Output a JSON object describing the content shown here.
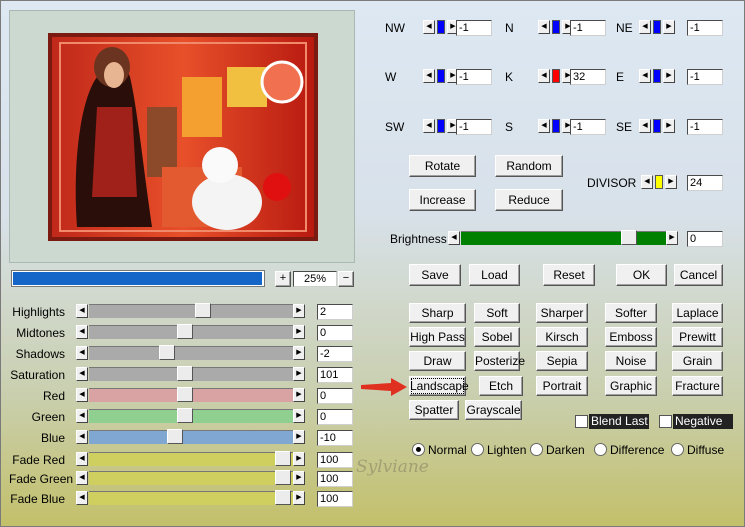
{
  "colors": {
    "thumb_blue": "#0000ff",
    "thumb_red": "#ff0000",
    "thumb_yellow": "#ffff00",
    "progress": "#1565c8",
    "brightness": "#008000",
    "arrow": "#e03020"
  },
  "compass": {
    "nw": {
      "label": "NW",
      "value": "-1"
    },
    "n": {
      "label": "N",
      "value": "-1"
    },
    "ne": {
      "label": "NE",
      "value": "-1"
    },
    "w": {
      "label": "W",
      "value": "-1"
    },
    "k": {
      "label": "K",
      "value": "32"
    },
    "e": {
      "label": "E",
      "value": "-1"
    },
    "sw": {
      "label": "SW",
      "value": "-1"
    },
    "s": {
      "label": "S",
      "value": "-1"
    },
    "se": {
      "label": "SE",
      "value": "-1"
    }
  },
  "actions": {
    "rotate": "Rotate",
    "random": "Random",
    "increase": "Increase",
    "reduce": "Reduce"
  },
  "divisor": {
    "label": "DIVISOR",
    "value": "24"
  },
  "brightness": {
    "label": "Brightness",
    "value": "0",
    "level": 0.82
  },
  "progress": {
    "fill": 0.99,
    "zoom_in": "+",
    "zoom": "25%",
    "zoom_out": "−"
  },
  "file_buttons": {
    "save": "Save",
    "load": "Load",
    "reset": "Reset",
    "ok": "OK",
    "cancel": "Cancel"
  },
  "presets": [
    [
      "Sharp",
      "Soft",
      "Sharper",
      "Softer",
      "Laplace"
    ],
    [
      "High Pass",
      "Sobel",
      "Kirsch",
      "Emboss",
      "Prewitt"
    ],
    [
      "Draw",
      "Posterize",
      "Sepia",
      "Noise",
      "Grain"
    ],
    [
      "Landscape",
      "Etch",
      "Portrait",
      "Graphic",
      "Fracture"
    ],
    [
      "Spatter",
      "Grayscale"
    ]
  ],
  "options": {
    "blend_last": "Blend Last",
    "negative": "Negative"
  },
  "modes": [
    "Normal",
    "Lighten",
    "Darken",
    "Difference",
    "Diffuse"
  ],
  "selected_mode": "Normal",
  "sliders": [
    {
      "label": "Highlights",
      "value": "2",
      "pos": 0.56,
      "color": "#aaaaaa"
    },
    {
      "label": "Midtones",
      "value": "0",
      "pos": 0.47,
      "color": "#aaaaaa"
    },
    {
      "label": "Shadows",
      "value": "-2",
      "pos": 0.38,
      "color": "#aaaaaa"
    },
    {
      "label": "Saturation",
      "value": "101",
      "pos": 0.47,
      "color": "#aaaaaa"
    },
    {
      "label": "Red",
      "value": "0",
      "pos": 0.47,
      "color": "#d9a3a3"
    },
    {
      "label": "Green",
      "value": "0",
      "pos": 0.47,
      "color": "#8fcf8f"
    },
    {
      "label": "Blue",
      "value": "-10",
      "pos": 0.42,
      "color": "#7fa7d1"
    },
    {
      "label": "Fade Red",
      "value": "100",
      "pos": 0.95,
      "color": "#cfcf60"
    },
    {
      "label": "Fade Green",
      "value": "100",
      "pos": 0.95,
      "color": "#cfcf60"
    },
    {
      "label": "Fade Blue",
      "value": "100",
      "pos": 0.95,
      "color": "#cfcf60"
    }
  ],
  "watermark": "Sylviane"
}
